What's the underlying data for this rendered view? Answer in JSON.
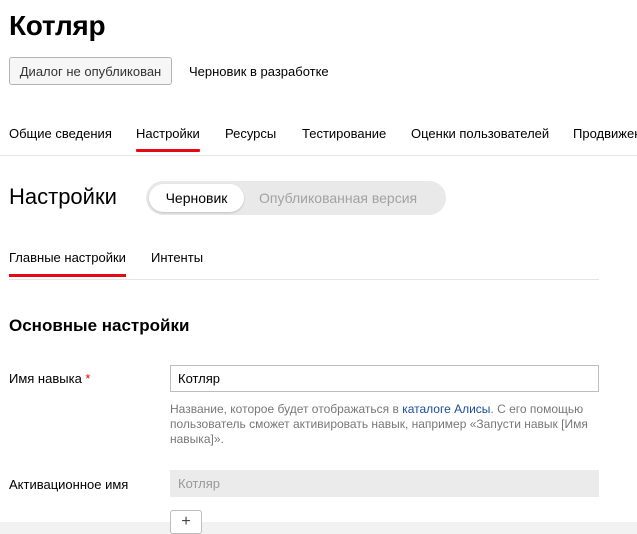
{
  "header": {
    "title": "Котляр",
    "status_button": "Диалог не опубликован",
    "draft_status": "Черновик в разработке"
  },
  "nav_tabs": [
    {
      "label": "Общие сведения",
      "active": false
    },
    {
      "label": "Настройки",
      "active": true
    },
    {
      "label": "Ресурсы",
      "active": false
    },
    {
      "label": "Тестирование",
      "active": false
    },
    {
      "label": "Оценки пользователей",
      "active": false
    },
    {
      "label": "Продвижение",
      "active": false
    }
  ],
  "settings": {
    "title": "Настройки",
    "version_toggle": {
      "selected": "Черновик",
      "other": "Опубликованная версия"
    },
    "subtabs": [
      {
        "label": "Главные настройки",
        "active": true
      },
      {
        "label": "Интенты",
        "active": false
      }
    ],
    "section_title": "Основные настройки",
    "skill_name": {
      "label": "Имя навыка",
      "required_mark": "*",
      "value": "Котляр",
      "hint_before": "Название, которое будет отображаться в ",
      "hint_link": "каталоге Алисы",
      "hint_after": ". С его помощью пользователь сможет активировать навык, например «Запусти навык [Имя навыка]»."
    },
    "activation_name": {
      "label": "Активационное имя",
      "value": "Котляр"
    },
    "add_button": "+"
  },
  "colors": {
    "accent": "#e50914",
    "link": "#1a4ea0"
  }
}
